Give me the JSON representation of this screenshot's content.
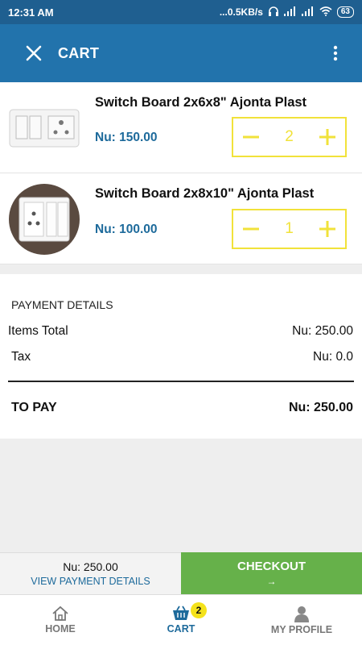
{
  "status_bar": {
    "time": "12:31 AM",
    "network_speed": "...0.5KB/s",
    "battery": "63"
  },
  "app_bar": {
    "title": "CART"
  },
  "cart": {
    "items": [
      {
        "name": "Switch Board 2x6x8\" Ajonta Plast",
        "price": "Nu: 150.00",
        "quantity": "2"
      },
      {
        "name": "Switch Board 2x8x10\" Ajonta Plast",
        "price": "Nu: 100.00",
        "quantity": "1"
      }
    ]
  },
  "payment": {
    "heading": "PAYMENT DETAILS",
    "items_total_label": "Items Total",
    "items_total_value": "Nu: 250.00",
    "tax_label": "Tax",
    "tax_value": "Nu: 0.0",
    "to_pay_label": "TO PAY",
    "to_pay_value": "Nu: 250.00"
  },
  "actions": {
    "summary_amount": "Nu: 250.00",
    "view_details": "VIEW PAYMENT DETAILS",
    "checkout": "CHECKOUT",
    "checkout_arrow": "→"
  },
  "bottom_nav": {
    "home": "HOME",
    "cart": "CART",
    "cart_badge": "2",
    "profile": "MY PROFILE"
  },
  "colors": {
    "app_bar": "#2273ac",
    "price": "#1d6a9b",
    "stepper": "#f1e23a",
    "checkout": "#66b14a",
    "badge": "#f4e21b"
  },
  "icons": [
    "close-icon",
    "more-vert-icon",
    "minus-icon",
    "plus-icon",
    "home-icon",
    "cart-icon",
    "profile-icon",
    "wifi-icon",
    "signal-icon",
    "headphones-icon"
  ]
}
